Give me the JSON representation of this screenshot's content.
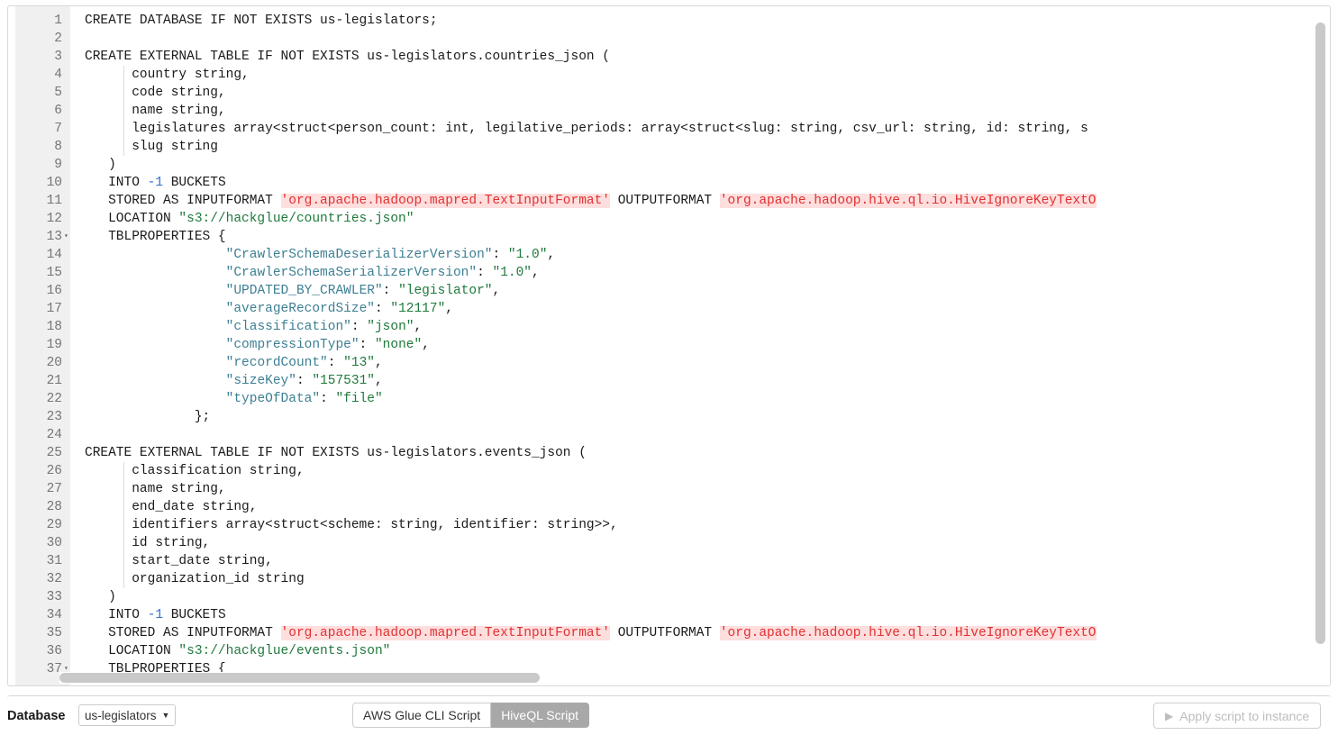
{
  "editor": {
    "language": "hiveql",
    "first_visible_line": 1,
    "last_visible_line": 37,
    "lines": [
      {
        "n": "1",
        "indent_guide": false,
        "fold": "",
        "text": "CREATE DATABASE IF NOT EXISTS us-legislators;"
      },
      {
        "n": "2",
        "indent_guide": false,
        "fold": "",
        "text": ""
      },
      {
        "n": "3",
        "indent_guide": false,
        "fold": "",
        "text": "CREATE EXTERNAL TABLE IF NOT EXISTS us-legislators.countries_json ("
      },
      {
        "n": "4",
        "indent_guide": true,
        "fold": "",
        "text": "      country string,"
      },
      {
        "n": "5",
        "indent_guide": true,
        "fold": "",
        "text": "      code string,"
      },
      {
        "n": "6",
        "indent_guide": true,
        "fold": "",
        "text": "      name string,"
      },
      {
        "n": "7",
        "indent_guide": true,
        "fold": "",
        "text": "      legislatures array<struct<person_count: int, legilative_periods: array<struct<slug: string, csv_url: string, id: string, s"
      },
      {
        "n": "8",
        "indent_guide": true,
        "fold": "",
        "text": "      slug string"
      },
      {
        "n": "9",
        "indent_guide": false,
        "fold": "",
        "text": "   )"
      },
      {
        "n": "10",
        "indent_guide": false,
        "fold": "",
        "text": "   INTO -1 BUCKETS"
      },
      {
        "n": "11",
        "indent_guide": false,
        "fold": "",
        "text": "   STORED AS INPUTFORMAT 'org.apache.hadoop.mapred.TextInputFormat' OUTPUTFORMAT 'org.apache.hadoop.hive.ql.io.HiveIgnoreKeyTextO"
      },
      {
        "n": "12",
        "indent_guide": false,
        "fold": "",
        "text": "   LOCATION \"s3://hackglue/countries.json\""
      },
      {
        "n": "13",
        "indent_guide": false,
        "fold": "▾",
        "text": "   TBLPROPERTIES {"
      },
      {
        "n": "14",
        "indent_guide": false,
        "fold": "",
        "text": "                  \"CrawlerSchemaDeserializerVersion\": \"1.0\","
      },
      {
        "n": "15",
        "indent_guide": false,
        "fold": "",
        "text": "                  \"CrawlerSchemaSerializerVersion\": \"1.0\","
      },
      {
        "n": "16",
        "indent_guide": false,
        "fold": "",
        "text": "                  \"UPDATED_BY_CRAWLER\": \"legislator\","
      },
      {
        "n": "17",
        "indent_guide": false,
        "fold": "",
        "text": "                  \"averageRecordSize\": \"12117\","
      },
      {
        "n": "18",
        "indent_guide": false,
        "fold": "",
        "text": "                  \"classification\": \"json\","
      },
      {
        "n": "19",
        "indent_guide": false,
        "fold": "",
        "text": "                  \"compressionType\": \"none\","
      },
      {
        "n": "20",
        "indent_guide": false,
        "fold": "",
        "text": "                  \"recordCount\": \"13\","
      },
      {
        "n": "21",
        "indent_guide": false,
        "fold": "",
        "text": "                  \"sizeKey\": \"157531\","
      },
      {
        "n": "22",
        "indent_guide": false,
        "fold": "",
        "text": "                  \"typeOfData\": \"file\""
      },
      {
        "n": "23",
        "indent_guide": false,
        "fold": "",
        "text": "              };"
      },
      {
        "n": "24",
        "indent_guide": false,
        "fold": "",
        "text": ""
      },
      {
        "n": "25",
        "indent_guide": false,
        "fold": "",
        "text": "CREATE EXTERNAL TABLE IF NOT EXISTS us-legislators.events_json ("
      },
      {
        "n": "26",
        "indent_guide": true,
        "fold": "",
        "text": "      classification string,"
      },
      {
        "n": "27",
        "indent_guide": true,
        "fold": "",
        "text": "      name string,"
      },
      {
        "n": "28",
        "indent_guide": true,
        "fold": "",
        "text": "      end_date string,"
      },
      {
        "n": "29",
        "indent_guide": true,
        "fold": "",
        "text": "      identifiers array<struct<scheme: string, identifier: string>>,"
      },
      {
        "n": "30",
        "indent_guide": true,
        "fold": "",
        "text": "      id string,"
      },
      {
        "n": "31",
        "indent_guide": true,
        "fold": "",
        "text": "      start_date string,"
      },
      {
        "n": "32",
        "indent_guide": true,
        "fold": "",
        "text": "      organization_id string"
      },
      {
        "n": "33",
        "indent_guide": false,
        "fold": "",
        "text": "   )"
      },
      {
        "n": "34",
        "indent_guide": false,
        "fold": "",
        "text": "   INTO -1 BUCKETS"
      },
      {
        "n": "35",
        "indent_guide": false,
        "fold": "",
        "text": "   STORED AS INPUTFORMAT 'org.apache.hadoop.mapred.TextInputFormat' OUTPUTFORMAT 'org.apache.hadoop.hive.ql.io.HiveIgnoreKeyTextO"
      },
      {
        "n": "36",
        "indent_guide": false,
        "fold": "",
        "text": "   LOCATION \"s3://hackglue/events.json\""
      },
      {
        "n": "37",
        "indent_guide": false,
        "fold": "▾",
        "text": "   TBLPROPERTIES {"
      }
    ]
  },
  "toolbar": {
    "database_label": "Database",
    "database_value": "us-legislators",
    "caret_icon": "chevron-down-icon",
    "script_tabs": [
      {
        "label": "AWS Glue CLI Script",
        "active": false
      },
      {
        "label": "HiveQL Script",
        "active": true
      }
    ],
    "apply_button": {
      "label": "Apply script to instance",
      "icon": "play-icon",
      "enabled": false
    }
  },
  "colors": {
    "string_green": "#1f7a3d",
    "json_key_blue": "#3d7f93",
    "number_blue": "#2f6fcf",
    "error_red": "#e03131",
    "error_bg": "#ffdede",
    "gutter_bg": "#f0f0f0",
    "active_tab_bg": "#a8a8a8",
    "scrollbar_thumb": "#c9c9c9"
  }
}
